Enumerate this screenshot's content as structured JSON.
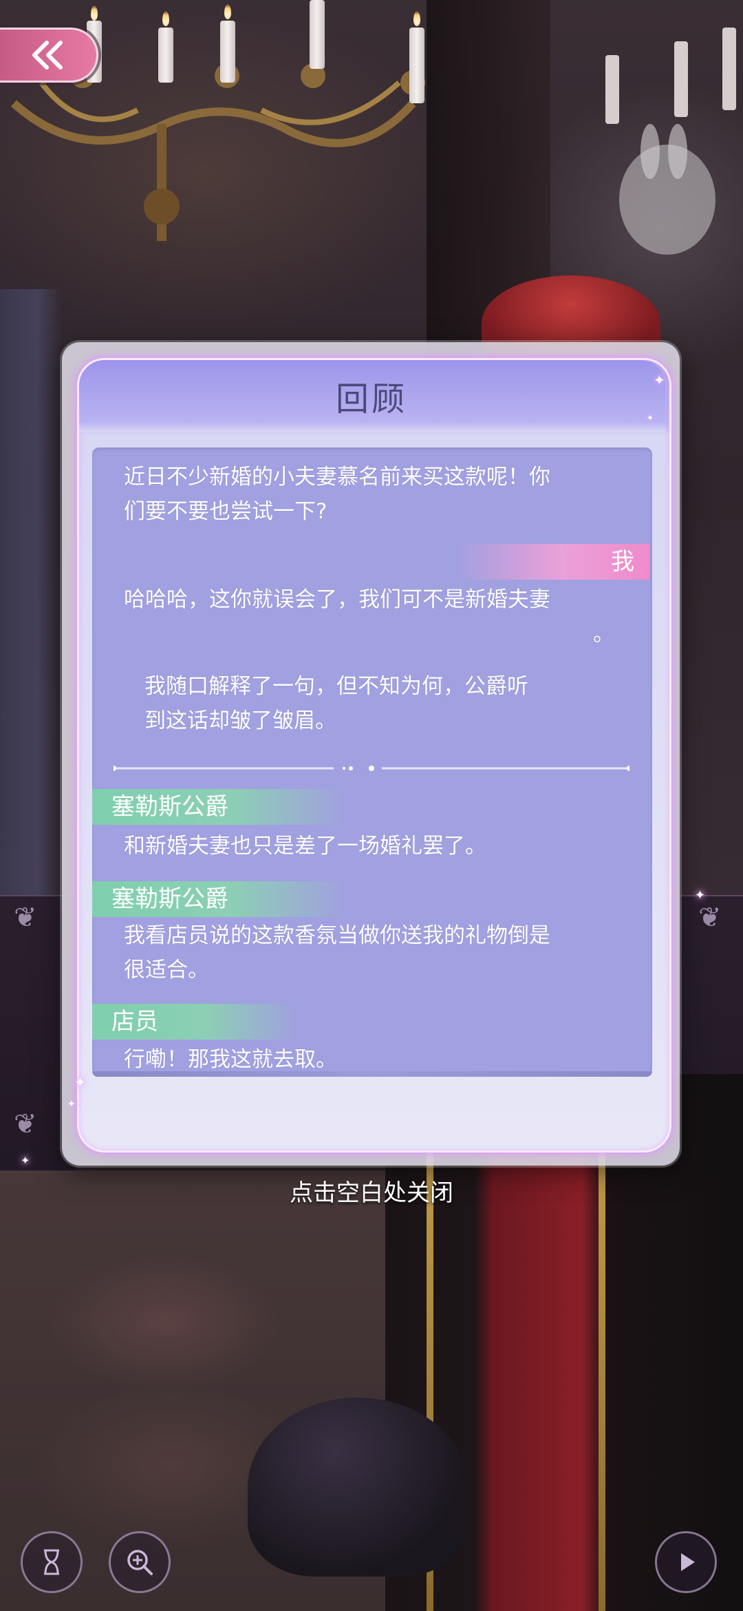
{
  "dialog": {
    "title": "回顾",
    "close_hint": "点击空白处关闭"
  },
  "log": [
    {
      "speaker": "",
      "lines": [
        "近日不少新婚的小夫妻慕名前来买这款呢！你",
        "们要不要也尝试一下?"
      ]
    },
    {
      "speaker": "我",
      "lines": [
        "哈哈哈，这你就误会了，我们可不是新婚夫妻",
        "。"
      ]
    },
    {
      "speaker": "",
      "lines": [
        "我随口解释了一句，但不知为何，公爵听",
        "到这话却皱了皱眉。"
      ]
    },
    {
      "speaker": "塞勒斯公爵",
      "lines": [
        "和新婚夫妻也只是差了一场婚礼罢了。"
      ]
    },
    {
      "speaker": "塞勒斯公爵",
      "lines": [
        "我看店员说的这款香氛当做你送我的礼物倒是",
        "很适合。"
      ]
    },
    {
      "speaker": "店员",
      "lines": [
        "行嘞！那我这就去取。"
      ]
    }
  ],
  "icons": {
    "back": "double-chevron-left-icon",
    "hourglass": "hourglass-icon",
    "zoom": "zoom-in-icon",
    "play": "play-icon"
  },
  "colors": {
    "back_button": "#e77aa4",
    "dialog_header": "#9c95ea",
    "log_background": "#a1a0e0",
    "speaker_npc": "#7fcfae",
    "speaker_player": "#f08bcb"
  }
}
